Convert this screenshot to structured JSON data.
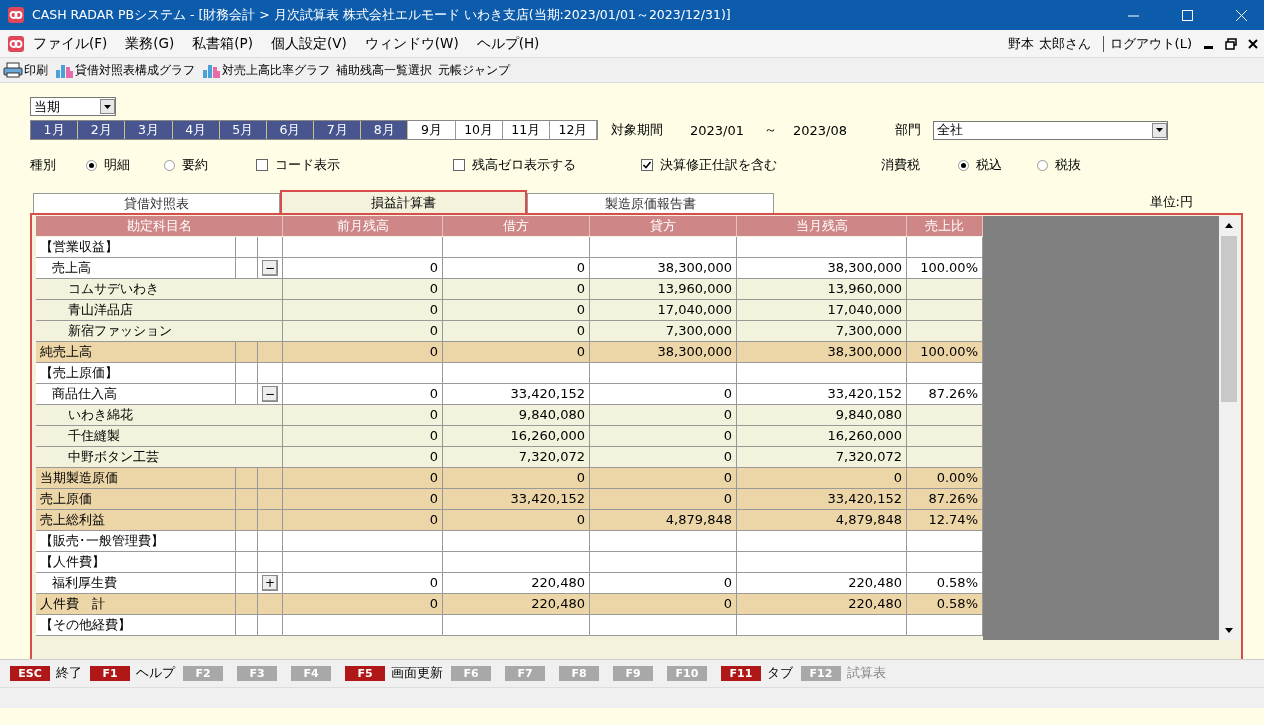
{
  "window": {
    "title": "CASH RADAR PBシステム - [財務会計 > 月次試算表 株式会社エルモード いわき支店(当期:2023/01/01～2023/12/31)]"
  },
  "menu": [
    "ファイル(F)",
    "業務(G)",
    "私書箱(P)",
    "個人設定(V)",
    "ウィンドウ(W)",
    "ヘルプ(H)"
  ],
  "user": {
    "name": "野本 太郎さん",
    "logout": "ログアウト(L)"
  },
  "toolbar": [
    {
      "label": "印刷",
      "kind": "print"
    },
    {
      "label": "貸借対照表構成グラフ",
      "kind": "chart"
    },
    {
      "label": "対売上高比率グラフ",
      "kind": "chart"
    },
    {
      "label": "補助残高一覧選択",
      "kind": "text"
    },
    {
      "label": "元帳ジャンプ",
      "kind": "text"
    }
  ],
  "period_select": {
    "value": "当期"
  },
  "months": [
    {
      "label": "1月",
      "selected": true
    },
    {
      "label": "2月",
      "selected": true
    },
    {
      "label": "3月",
      "selected": true
    },
    {
      "label": "4月",
      "selected": true
    },
    {
      "label": "5月",
      "selected": true
    },
    {
      "label": "6月",
      "selected": true
    },
    {
      "label": "7月",
      "selected": true
    },
    {
      "label": "8月",
      "selected": true
    },
    {
      "label": "9月",
      "selected": false
    },
    {
      "label": "10月",
      "selected": false
    },
    {
      "label": "11月",
      "selected": false
    },
    {
      "label": "12月",
      "selected": false
    }
  ],
  "range": {
    "label": "対象期間",
    "from": "2023/01",
    "sep": "～",
    "to": "2023/08"
  },
  "department": {
    "label": "部門",
    "value": "全社"
  },
  "type_label": "種別",
  "type_options": [
    {
      "label": "明細",
      "selected": true
    },
    {
      "label": "要約",
      "selected": false
    }
  ],
  "checks": [
    {
      "label": "コード表示",
      "checked": false
    },
    {
      "label": "残高ゼロ表示する",
      "checked": false
    },
    {
      "label": "決算修正仕訳を含む",
      "checked": true
    }
  ],
  "tax_label": "消費税",
  "tax_options": [
    {
      "label": "税込",
      "selected": true
    },
    {
      "label": "税抜",
      "selected": false
    }
  ],
  "tabs": [
    {
      "label": "貸借対照表",
      "selected": false
    },
    {
      "label": "損益計算書",
      "selected": true
    },
    {
      "label": "製造原価報告書",
      "selected": false
    }
  ],
  "unit": "単位:円",
  "table": {
    "columns": [
      "勘定科目名",
      "前月残高",
      "借方",
      "貸方",
      "当月残高",
      "売上比"
    ],
    "rows": [
      {
        "kind": "section",
        "name": "【営業収益】"
      },
      {
        "kind": "account",
        "name": "売上高",
        "toggle": "−",
        "prev": "0",
        "debit": "0",
        "credit": "38,300,000",
        "balance": "38,300,000",
        "ratio": "100.00%"
      },
      {
        "kind": "sub",
        "name": "コムサデいわき",
        "prev": "0",
        "debit": "0",
        "credit": "13,960,000",
        "balance": "13,960,000"
      },
      {
        "kind": "sub",
        "name": "青山洋品店",
        "prev": "0",
        "debit": "0",
        "credit": "17,040,000",
        "balance": "17,040,000"
      },
      {
        "kind": "sub",
        "name": "新宿ファッション",
        "prev": "0",
        "debit": "0",
        "credit": "7,300,000",
        "balance": "7,300,000"
      },
      {
        "kind": "total",
        "name": "純売上高",
        "prev": "0",
        "debit": "0",
        "credit": "38,300,000",
        "balance": "38,300,000",
        "ratio": "100.00%"
      },
      {
        "kind": "section",
        "name": "【売上原価】"
      },
      {
        "kind": "account",
        "name": "商品仕入高",
        "toggle": "−",
        "prev": "0",
        "debit": "33,420,152",
        "credit": "0",
        "balance": "33,420,152",
        "ratio": "87.26%"
      },
      {
        "kind": "sub",
        "name": "いわき綿花",
        "prev": "0",
        "debit": "9,840,080",
        "credit": "0",
        "balance": "9,840,080"
      },
      {
        "kind": "sub",
        "name": "千住縫製",
        "prev": "0",
        "debit": "16,260,000",
        "credit": "0",
        "balance": "16,260,000"
      },
      {
        "kind": "sub",
        "name": "中野ボタン工芸",
        "prev": "0",
        "debit": "7,320,072",
        "credit": "0",
        "balance": "7,320,072"
      },
      {
        "kind": "total",
        "name": "当期製造原価",
        "prev": "0",
        "debit": "0",
        "credit": "0",
        "balance": "0",
        "ratio": "0.00%"
      },
      {
        "kind": "total",
        "name": "売上原価",
        "prev": "0",
        "debit": "33,420,152",
        "credit": "0",
        "balance": "33,420,152",
        "ratio": "87.26%"
      },
      {
        "kind": "total",
        "name": "売上総利益",
        "prev": "0",
        "debit": "0",
        "credit": "4,879,848",
        "balance": "4,879,848",
        "ratio": "12.74%"
      },
      {
        "kind": "section",
        "name": "【販売･一般管理費】"
      },
      {
        "kind": "section",
        "name": "【人件費】"
      },
      {
        "kind": "account",
        "name": "福利厚生費",
        "toggle": "+",
        "prev": "0",
        "debit": "220,480",
        "credit": "0",
        "balance": "220,480",
        "ratio": "0.58%"
      },
      {
        "kind": "total",
        "name": "人件費　計",
        "prev": "0",
        "debit": "220,480",
        "credit": "0",
        "balance": "220,480",
        "ratio": "0.58%"
      },
      {
        "kind": "section",
        "name": "【その他経費】"
      }
    ]
  },
  "fkeys": [
    {
      "key": "ESC",
      "label": "終了",
      "enabled": true
    },
    {
      "key": "F1",
      "label": "ヘルプ",
      "enabled": true
    },
    {
      "key": "F2",
      "enabled": false
    },
    {
      "key": "F3",
      "enabled": false
    },
    {
      "key": "F4",
      "enabled": false
    },
    {
      "key": "F5",
      "label": "画面更新",
      "enabled": true
    },
    {
      "key": "F6",
      "enabled": false
    },
    {
      "key": "F7",
      "enabled": false
    },
    {
      "key": "F8",
      "enabled": false
    },
    {
      "key": "F9",
      "enabled": false
    },
    {
      "key": "F10",
      "enabled": false
    },
    {
      "key": "F11",
      "label": "タブ",
      "enabled": true
    },
    {
      "key": "F12",
      "label": "試算表",
      "enabled": false
    }
  ]
}
